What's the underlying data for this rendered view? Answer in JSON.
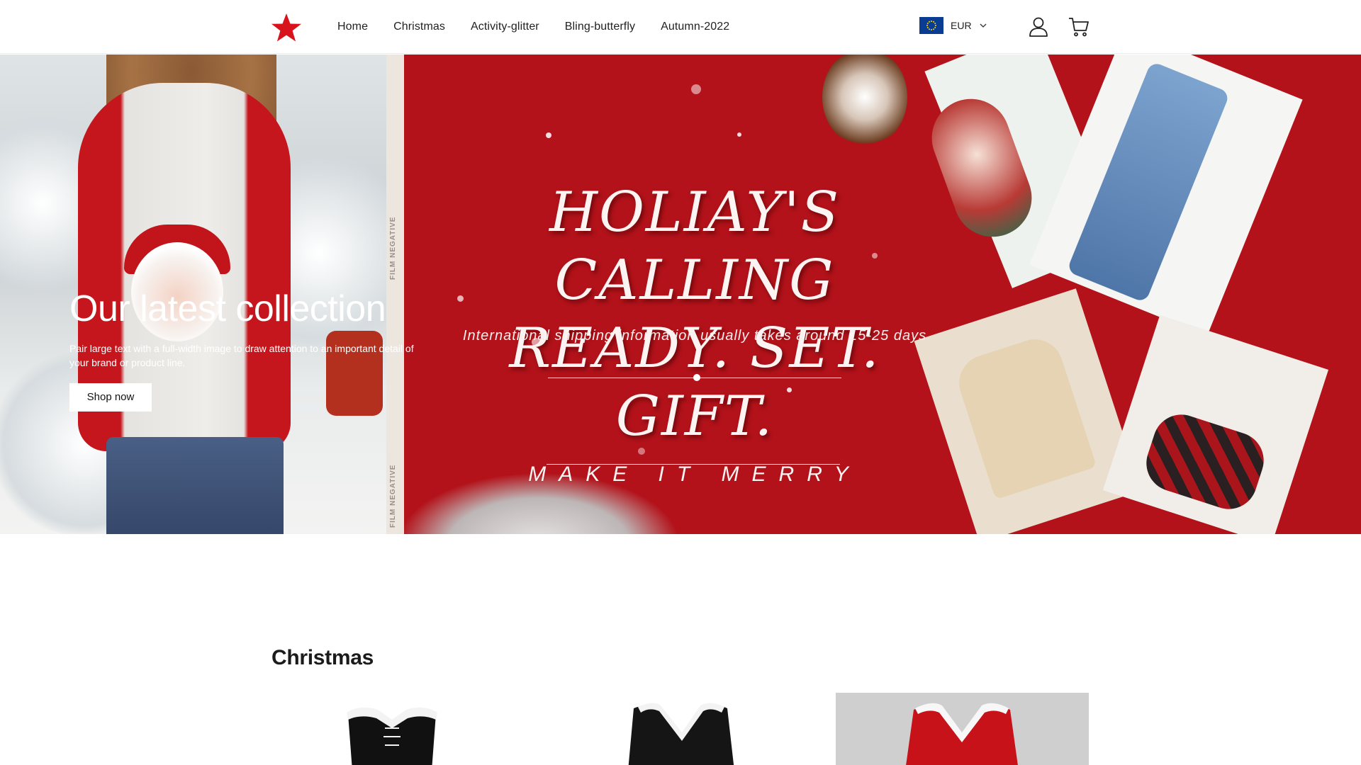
{
  "brand": {
    "logo_icon": "red-star-icon",
    "accent": "#d7141c"
  },
  "nav": {
    "items": [
      {
        "label": "Home"
      },
      {
        "label": "Christmas"
      },
      {
        "label": "Activity-glitter"
      },
      {
        "label": "Bling-butterfly"
      },
      {
        "label": "Autumn-2022"
      }
    ]
  },
  "currency": {
    "code": "EUR",
    "flag_icon": "eu-flag-icon"
  },
  "header_icons": {
    "account": "user-icon",
    "cart": "cart-icon"
  },
  "hero": {
    "overlay_heading": "Our latest collection",
    "overlay_text": "Pair large text with a full-width image to draw attention to an important detail of your brand or product line.",
    "button_label": "Shop now",
    "banner_title_line1": "HOLIAY'S CALLING",
    "banner_title_line2": "READY. SET. GIFT.",
    "banner_shipping": "International shipping information usually takes around 15-25 days",
    "banner_tagline": "MAKE IT MERRY",
    "film_label": "FILM NEGATIVE"
  },
  "section": {
    "title": "Christmas",
    "products": [
      {
        "name": "black-lace-up-fur-trim-dress"
      },
      {
        "name": "black-v-neck-fur-trim-dress"
      },
      {
        "name": "red-v-neck-fur-trim-dress"
      }
    ]
  }
}
